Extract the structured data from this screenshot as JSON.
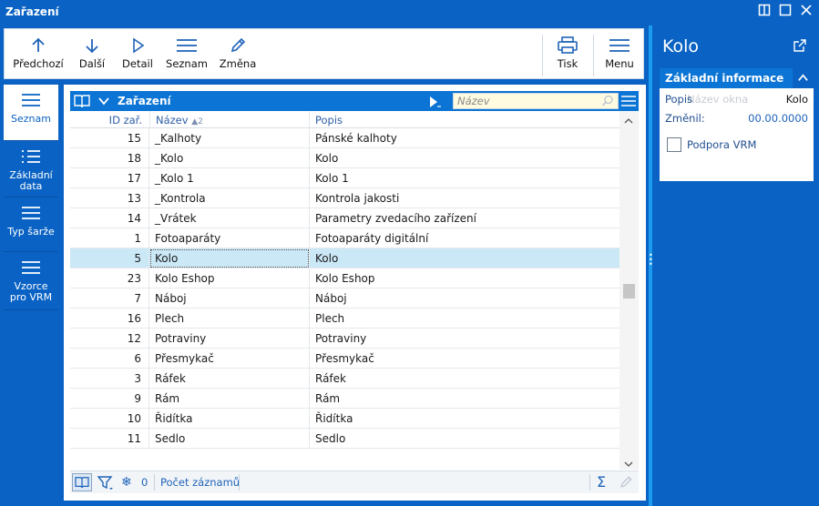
{
  "window": {
    "title": "Zařazení"
  },
  "toolbar": {
    "prev_label": "Předchozí",
    "next_label": "Další",
    "detail_label": "Detail",
    "list_label": "Seznam",
    "edit_label": "Změna",
    "print_label": "Tisk",
    "menu_label": "Menu"
  },
  "sidebar": {
    "items": [
      {
        "label": "Seznam"
      },
      {
        "label": "Základní\ndata"
      },
      {
        "label": "Typ šarže"
      },
      {
        "label": "Vzorce\npro VRM"
      }
    ]
  },
  "grid": {
    "title": "Zařazení",
    "search_placeholder": "Název",
    "columns": {
      "id": "ID zař.",
      "name": "Název",
      "name_sort_index": "2",
      "desc": "Popis"
    },
    "rows": [
      {
        "id": "15",
        "name": "_Kalhoty",
        "desc": "Pánské kalhoty"
      },
      {
        "id": "18",
        "name": "_Kolo",
        "desc": "Kolo"
      },
      {
        "id": "17",
        "name": "_Kolo 1",
        "desc": "Kolo 1"
      },
      {
        "id": "13",
        "name": "_Kontrola",
        "desc": "Kontrola jakosti"
      },
      {
        "id": "14",
        "name": "_Vrátek",
        "desc": "Parametry zvedacího zařízení"
      },
      {
        "id": "1",
        "name": "Fotoaparáty",
        "desc": "Fotoaparáty digitální"
      },
      {
        "id": "5",
        "name": "Kolo",
        "desc": "Kolo",
        "selected": true
      },
      {
        "id": "23",
        "name": "Kolo Eshop",
        "desc": "Kolo Eshop"
      },
      {
        "id": "7",
        "name": "Náboj",
        "desc": "Náboj"
      },
      {
        "id": "16",
        "name": "Plech",
        "desc": "Plech"
      },
      {
        "id": "12",
        "name": "Potraviny",
        "desc": "Potraviny"
      },
      {
        "id": "6",
        "name": "Přesmykač",
        "desc": "Přesmykač"
      },
      {
        "id": "3",
        "name": "Ráfek",
        "desc": "Ráfek"
      },
      {
        "id": "9",
        "name": "Rám",
        "desc": "Rám"
      },
      {
        "id": "10",
        "name": "Řidítka",
        "desc": "Řidítka"
      },
      {
        "id": "11",
        "name": "Sedlo",
        "desc": "Sedlo"
      }
    ],
    "footer": {
      "filter_count": "0",
      "record_count_label": "Počet záznamů"
    }
  },
  "detail": {
    "title": "Kolo",
    "section_title": "Základní informace",
    "fields": {
      "popis_label": "Popis",
      "popis_value": "Kolo",
      "ghost_text": "Název okna",
      "zmenil_label": "Změnil:",
      "zmenil_value": "00.00.0000",
      "vrm_label": "Podpora VRM"
    }
  },
  "colors": {
    "primary": "#0a63c4",
    "header": "#0b74d4",
    "selected_row": "#cbe8f7",
    "search_bg": "#fffbe0",
    "splitter": "#1a9bf0"
  }
}
